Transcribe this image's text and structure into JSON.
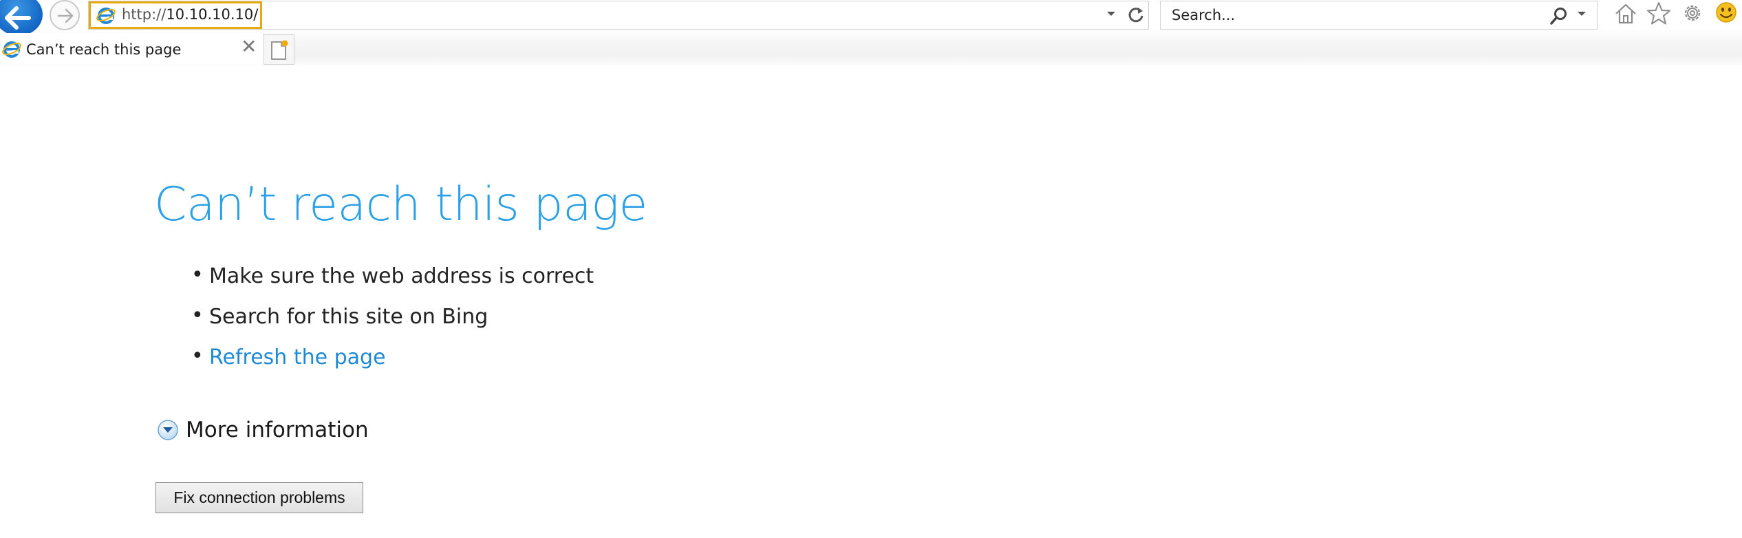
{
  "toolbar": {
    "address_scheme": "http://",
    "address_host": "10.10.10.10/",
    "search_placeholder": "Search...",
    "icons": [
      "back-arrow-icon",
      "forward-arrow-icon",
      "ie-logo-icon",
      "dropdown-arrow-icon",
      "refresh-icon",
      "search-icon",
      "home-icon",
      "favorites-star-icon",
      "settings-gear-icon",
      "smiley-feedback-icon"
    ],
    "accent_color": "#1366c4",
    "highlight_color": "#e6a911"
  },
  "tabs": [
    {
      "title": "Can’t reach this page",
      "active": true
    }
  ],
  "page": {
    "title": "Can’t reach this page",
    "title_color": "#2aa0e6",
    "tips": [
      {
        "text": "Make sure the web address is correct",
        "link": false
      },
      {
        "text": "Search for this site on Bing",
        "link": false
      },
      {
        "text": "Refresh the page",
        "link": true
      }
    ],
    "more_info_label": "More information",
    "fix_button_label": "Fix connection problems"
  }
}
